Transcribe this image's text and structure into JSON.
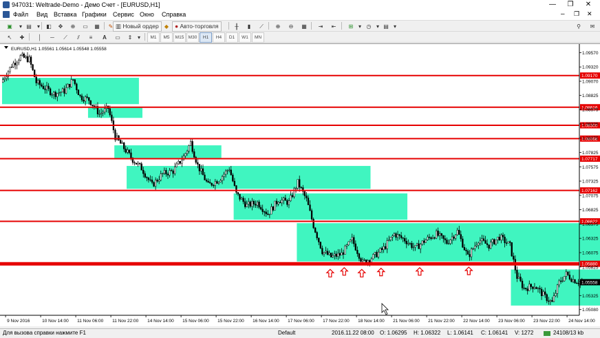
{
  "window": {
    "title": "947031: Weltrade-Demo - Демо Счет - [EURUSD,H1]",
    "min_glyph": "—",
    "restore_glyph": "❐",
    "close_glyph": "✕"
  },
  "menu": [
    "Файл",
    "Вид",
    "Вставка",
    "Графики",
    "Сервис",
    "Окно",
    "Справка"
  ],
  "toolbar": {
    "new_order": "Новый ордер",
    "auto_trading": "Авто-торговля",
    "timeframes": [
      "M1",
      "M5",
      "M15",
      "M30",
      "H1",
      "H4",
      "D1",
      "W1",
      "MN"
    ]
  },
  "chart_data": {
    "type": "candlestick",
    "symbol_header": "EURUSD,H1  1.05561 1.05614 1.05548 1.05558",
    "price_ticks": [
      {
        "v": 1.0957,
        "label": "1.09570"
      },
      {
        "v": 1.0932,
        "label": "1.09320"
      },
      {
        "v": 1.0907,
        "label": "1.09070"
      },
      {
        "v": 1.08825,
        "label": "1.08825"
      },
      {
        "v": 1.08575,
        "label": "1.08575"
      },
      {
        "v": 1.08325,
        "label": "1.08325"
      },
      {
        "v": 1.08075,
        "label": "1.08075"
      },
      {
        "v": 1.07825,
        "label": "1.07825"
      },
      {
        "v": 1.07575,
        "label": "1.07575"
      },
      {
        "v": 1.07325,
        "label": "1.07325"
      },
      {
        "v": 1.07075,
        "label": "1.07075"
      },
      {
        "v": 1.06825,
        "label": "1.06825"
      },
      {
        "v": 1.06575,
        "label": "1.06575"
      },
      {
        "v": 1.06325,
        "label": "1.06325"
      },
      {
        "v": 1.06075,
        "label": "1.06075"
      },
      {
        "v": 1.05825,
        "label": "1.05825"
      },
      {
        "v": 1.05325,
        "label": "1.05325"
      },
      {
        "v": 1.0508,
        "label": "1.05080"
      }
    ],
    "levels": [
      {
        "v": 1.0917,
        "label": "1.09170"
      },
      {
        "v": 1.08616,
        "label": "1.08616"
      },
      {
        "v": 1.083,
        "label": "1.08300"
      },
      {
        "v": 1.08068,
        "label": "1.08068"
      },
      {
        "v": 1.07717,
        "label": "1.07717"
      },
      {
        "v": 1.07162,
        "label": "1.07162"
      },
      {
        "v": 1.06622,
        "label": "1.06622"
      },
      {
        "v": 1.0588,
        "label": "1.05880"
      }
    ],
    "current_price": {
      "v": 1.05558,
      "label": "1.05558"
    },
    "time_labels": [
      {
        "bar": 2,
        "label": "9 Nov 2016"
      },
      {
        "bar": 22,
        "label": "10 Nov 14:00"
      },
      {
        "bar": 42,
        "label": "11 Nov 06:00"
      },
      {
        "bar": 62,
        "label": "11 Nov 22:00"
      },
      {
        "bar": 82,
        "label": "14 Nov 14:00"
      },
      {
        "bar": 102,
        "label": "15 Nov 06:00"
      },
      {
        "bar": 122,
        "label": "15 Nov 22:00"
      },
      {
        "bar": 142,
        "label": "16 Nov 14:00"
      },
      {
        "bar": 162,
        "label": "17 Nov 06:00"
      },
      {
        "bar": 182,
        "label": "17 Nov 22:00"
      },
      {
        "bar": 202,
        "label": "18 Nov 14:00"
      },
      {
        "bar": 222,
        "label": "21 Nov 06:00"
      },
      {
        "bar": 242,
        "label": "21 Nov 22:00"
      },
      {
        "bar": 262,
        "label": "22 Nov 14:00"
      },
      {
        "bar": 282,
        "label": "23 Nov 06:00"
      },
      {
        "bar": 302,
        "label": "23 Nov 22:00"
      },
      {
        "bar": 322,
        "label": "24 Nov 14:00"
      }
    ],
    "zones": [
      {
        "bar_from": 0,
        "bar_to": 78,
        "price_lo": 1.0867,
        "price_hi": 1.0913
      },
      {
        "bar_from": 49,
        "bar_to": 80,
        "price_lo": 1.0843,
        "price_hi": 1.0861
      },
      {
        "bar_from": 64,
        "bar_to": 125,
        "price_lo": 1.0773,
        "price_hi": 1.0795
      },
      {
        "bar_from": 71,
        "bar_to": 210,
        "price_lo": 1.0719,
        "price_hi": 1.0759
      },
      {
        "bar_from": 132,
        "bar_to": 231,
        "price_lo": 1.0665,
        "price_hi": 1.0711
      },
      {
        "bar_from": 168,
        "bar_to": 356,
        "price_lo": 1.0592,
        "price_hi": 1.0659
      },
      {
        "bar_from": 290,
        "bar_to": 354,
        "price_lo": 1.0515,
        "price_hi": 1.0578
      }
    ],
    "arrows": [
      {
        "bar": 187,
        "price": 1.0571
      },
      {
        "bar": 195,
        "price": 1.0574
      },
      {
        "bar": 205,
        "price": 1.0571
      },
      {
        "bar": 216,
        "price": 1.0573
      },
      {
        "bar": 238,
        "price": 1.0574
      },
      {
        "bar": 266,
        "price": 1.0575
      }
    ],
    "path": [
      [
        0,
        1.0905
      ],
      [
        6,
        1.0935
      ],
      [
        11,
        1.095
      ],
      [
        16,
        1.0945
      ],
      [
        20,
        1.0905
      ],
      [
        25,
        1.0895
      ],
      [
        30,
        1.0885
      ],
      [
        36,
        1.089
      ],
      [
        41,
        1.091
      ],
      [
        45,
        1.088
      ],
      [
        50,
        1.0875
      ],
      [
        56,
        1.085
      ],
      [
        61,
        1.086
      ],
      [
        65,
        1.081
      ],
      [
        70,
        1.079
      ],
      [
        75,
        1.077
      ],
      [
        80,
        1.0755
      ],
      [
        86,
        1.0725
      ],
      [
        92,
        1.0745
      ],
      [
        98,
        1.075
      ],
      [
        104,
        1.0775
      ],
      [
        108,
        1.08
      ],
      [
        112,
        1.076
      ],
      [
        118,
        1.0725
      ],
      [
        124,
        1.0735
      ],
      [
        130,
        1.0755
      ],
      [
        134,
        1.071
      ],
      [
        140,
        1.069
      ],
      [
        146,
        1.0695
      ],
      [
        152,
        1.0675
      ],
      [
        158,
        1.07
      ],
      [
        164,
        1.0695
      ],
      [
        169,
        1.073
      ],
      [
        174,
        1.07
      ],
      [
        178,
        1.0655
      ],
      [
        183,
        1.061
      ],
      [
        188,
        1.06
      ],
      [
        194,
        1.0605
      ],
      [
        200,
        1.063
      ],
      [
        206,
        1.059
      ],
      [
        212,
        1.06
      ],
      [
        218,
        1.0615
      ],
      [
        224,
        1.064
      ],
      [
        230,
        1.063
      ],
      [
        236,
        1.0615
      ],
      [
        242,
        1.063
      ],
      [
        248,
        1.064
      ],
      [
        254,
        1.0625
      ],
      [
        260,
        1.0645
      ],
      [
        266,
        1.06
      ],
      [
        272,
        1.063
      ],
      [
        278,
        1.062
      ],
      [
        284,
        1.0635
      ],
      [
        290,
        1.062
      ],
      [
        294,
        1.0565
      ],
      [
        298,
        1.0545
      ],
      [
        304,
        1.055
      ],
      [
        310,
        1.053
      ],
      [
        314,
        1.052
      ],
      [
        318,
        1.0555
      ],
      [
        322,
        1.057
      ],
      [
        326,
        1.056
      ],
      [
        330,
        1.0556
      ]
    ]
  },
  "status": {
    "help": "Для вызова справки нажмите F1",
    "profile": "Default",
    "datetime": "2016.11.22 08:00",
    "open": "O: 1.06295",
    "high": "H: 1.06322",
    "low": "L: 1.06141",
    "close": "C: 1.06141",
    "volume": "V: 1272",
    "traffic": "24108/13 kb"
  },
  "colors": {
    "level": "#e60000",
    "zone": "#40f5c0",
    "candle": "#000000",
    "arrow": "#e60000"
  }
}
